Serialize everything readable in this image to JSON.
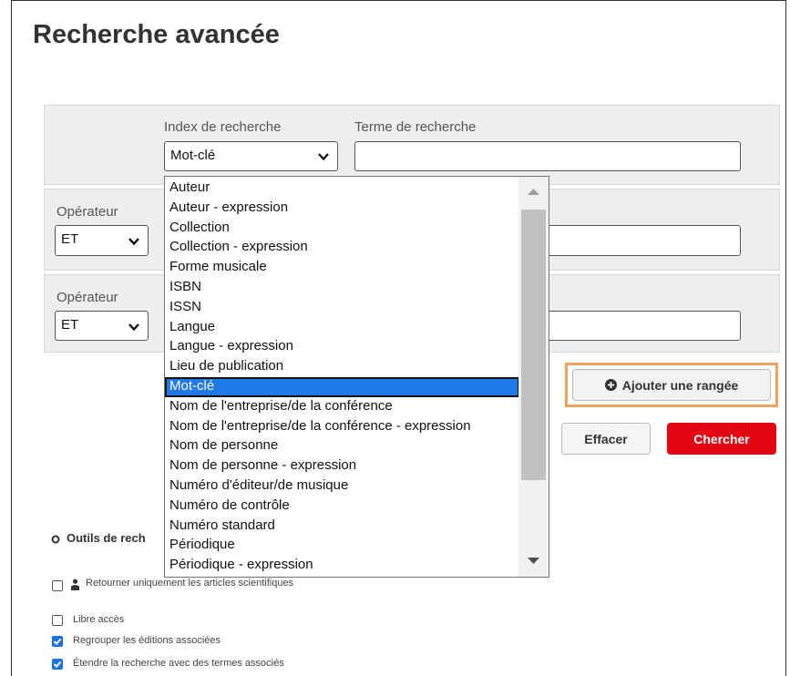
{
  "page": {
    "title": "Recherche avancée"
  },
  "row1": {
    "index_label": "Index de recherche",
    "term_label": "Terme de recherche",
    "index_value": "Mot-clé"
  },
  "row2": {
    "operator_label": "Opérateur",
    "operator_value": "ET"
  },
  "row3": {
    "operator_label": "Opérateur",
    "operator_value": "ET"
  },
  "dropdown": {
    "options": [
      "Auteur",
      "Auteur - expression",
      "Collection",
      "Collection - expression",
      "Forme musicale",
      "ISBN",
      "ISSN",
      "Langue",
      "Langue - expression",
      "Lieu de publication",
      "Mot-clé",
      "Nom de l'entreprise/de la conférence",
      "Nom de l'entreprise/de la conférence - expression",
      "Nom de personne",
      "Nom de personne - expression",
      "Numéro d'éditeur/de musique",
      "Numéro de contrôle",
      "Numéro standard",
      "Périodique",
      "Périodique - expression"
    ],
    "selected": "Mot-clé"
  },
  "buttons": {
    "add_row": "Ajouter une rangée",
    "clear": "Effacer",
    "search": "Chercher"
  },
  "tools": {
    "label": "Outils de rech"
  },
  "checkboxes": [
    {
      "label": "Retourner uniquement les articles scientifiques",
      "checked": false
    },
    {
      "label": "Libre accès",
      "checked": false
    },
    {
      "label": "Regrouper les éditions associées",
      "checked": true
    },
    {
      "label": "Étendre la recherche avec des termes associés",
      "checked": true
    }
  ],
  "colors": {
    "search_button": "#e30613",
    "selected_option": "#1f7ae8",
    "highlight_border": "#f0a35e"
  }
}
